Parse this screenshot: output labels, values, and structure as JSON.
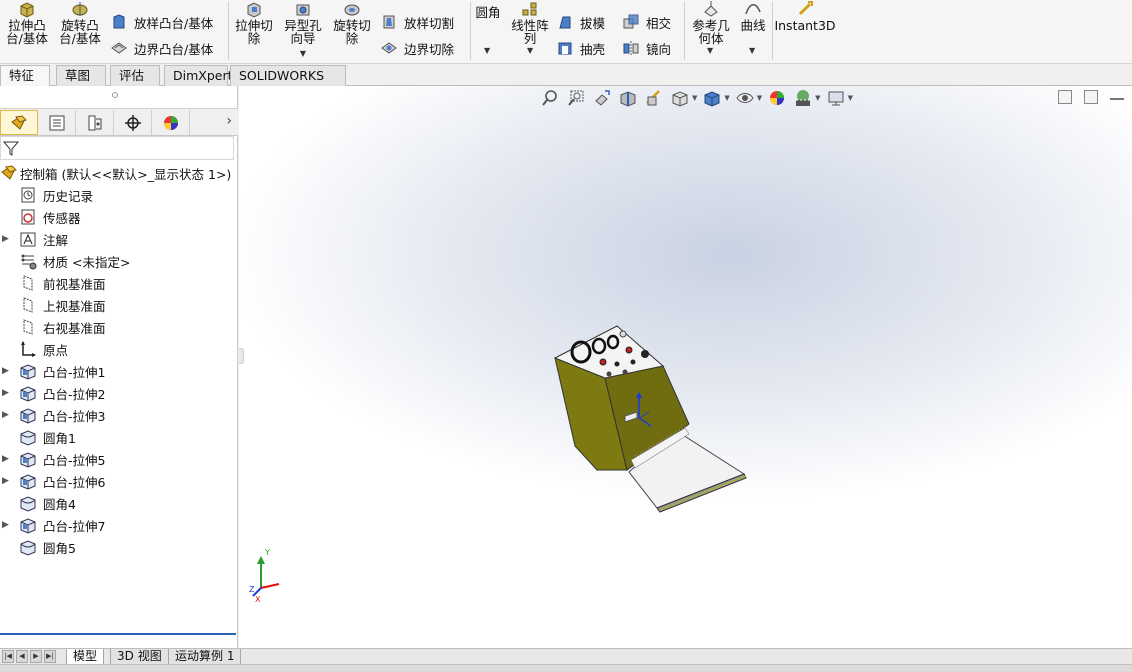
{
  "ribbon": {
    "buttons_large": [
      {
        "label": "拉伸凸\n台/基体"
      },
      {
        "label": "旋转凸\n台/基体"
      },
      {
        "label": "拉伸切\n除"
      },
      {
        "label": "异型孔\n向导"
      },
      {
        "label": "旋转切\n除"
      },
      {
        "label": "圆角"
      },
      {
        "label": "线性阵\n列"
      },
      {
        "label": "参考几\n何体"
      },
      {
        "label": "曲线"
      },
      {
        "label": "Instant3D"
      }
    ],
    "buttons_small": [
      {
        "label": "放样凸台/基体"
      },
      {
        "label": "边界凸台/基体"
      },
      {
        "label": "放样切割"
      },
      {
        "label": "边界切除"
      },
      {
        "label": "拔模"
      },
      {
        "label": "抽壳"
      },
      {
        "label": "相交"
      },
      {
        "label": "镜向"
      }
    ]
  },
  "command_tabs": [
    "特征",
    "草图",
    "评估",
    "DimXpert",
    "SOLIDWORKS 插件"
  ],
  "active_command_tab": "特征",
  "feature_tree": {
    "root": "控制箱  (默认<<默认>_显示状态 1>)",
    "items": [
      {
        "label": "历史记录",
        "icon": "history-icon",
        "expandable": false
      },
      {
        "label": "传感器",
        "icon": "sensor-icon",
        "expandable": false
      },
      {
        "label": "注解",
        "icon": "annotation-icon",
        "expandable": true
      },
      {
        "label": "材质 <未指定>",
        "icon": "material-icon",
        "expandable": false
      },
      {
        "label": "前视基准面",
        "icon": "plane-icon",
        "expandable": false
      },
      {
        "label": "上视基准面",
        "icon": "plane-icon",
        "expandable": false
      },
      {
        "label": "右视基准面",
        "icon": "plane-icon",
        "expandable": false
      },
      {
        "label": "原点",
        "icon": "origin-icon",
        "expandable": false
      },
      {
        "label": "凸台-拉伸1",
        "icon": "extrude-icon",
        "expandable": true
      },
      {
        "label": "凸台-拉伸2",
        "icon": "extrude-icon",
        "expandable": true
      },
      {
        "label": "凸台-拉伸3",
        "icon": "extrude-icon",
        "expandable": true
      },
      {
        "label": "圆角1",
        "icon": "fillet-icon",
        "expandable": false
      },
      {
        "label": "凸台-拉伸5",
        "icon": "extrude-icon",
        "expandable": true
      },
      {
        "label": "凸台-拉伸6",
        "icon": "extrude-icon",
        "expandable": true
      },
      {
        "label": "圆角4",
        "icon": "fillet-icon",
        "expandable": false
      },
      {
        "label": "凸台-拉伸7",
        "icon": "extrude-icon",
        "expandable": true
      },
      {
        "label": "圆角5",
        "icon": "fillet-icon",
        "expandable": false
      }
    ]
  },
  "triad": {
    "y": "Y",
    "x": "X",
    "z": "Z"
  },
  "bottom_tabs": [
    "模型",
    "3D 视图",
    "运动算例 1"
  ],
  "active_bottom_tab": "模型",
  "colors": {
    "accent": "#2b5fb5",
    "model_body": "#7d7a12",
    "model_panel": "#f4f4f4"
  }
}
